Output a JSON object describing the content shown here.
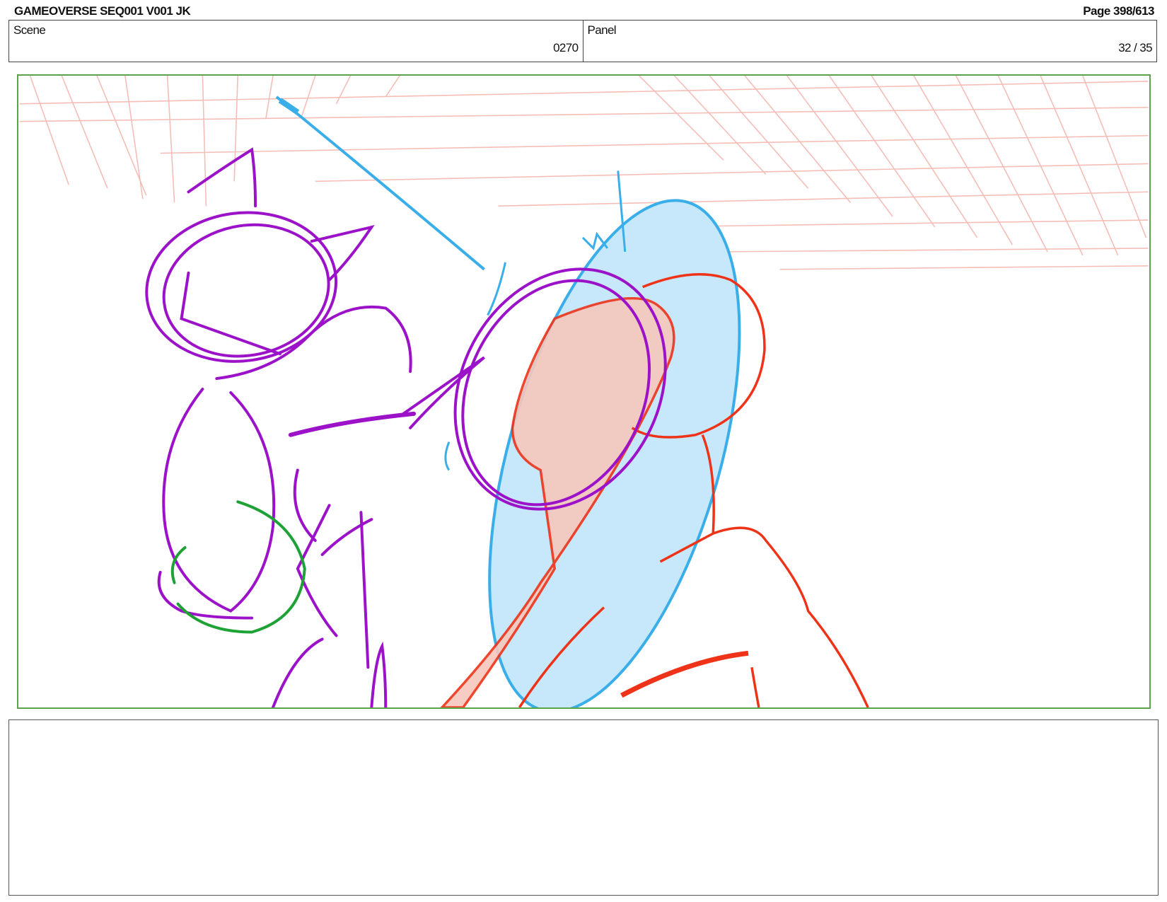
{
  "header": {
    "title": "GAMEOVERSE SEQ001 V001 JK",
    "page": "Page 398/613"
  },
  "info": {
    "scene_label": "Scene",
    "scene_value": "0270",
    "panel_label": "Panel",
    "panel_value": "32 / 35"
  },
  "colors": {
    "frame_border": "#5aa34a",
    "purple_sketch": "#9b12c9",
    "blue_sketch": "#3aaee8",
    "blue_fill": "#c6e8fa",
    "red_sketch": "#ee3318",
    "red_fill": "#f6c7bd",
    "green_sketch": "#1ea236",
    "grid_lines": "#f3b3ab"
  },
  "notes": {
    "text": ""
  }
}
